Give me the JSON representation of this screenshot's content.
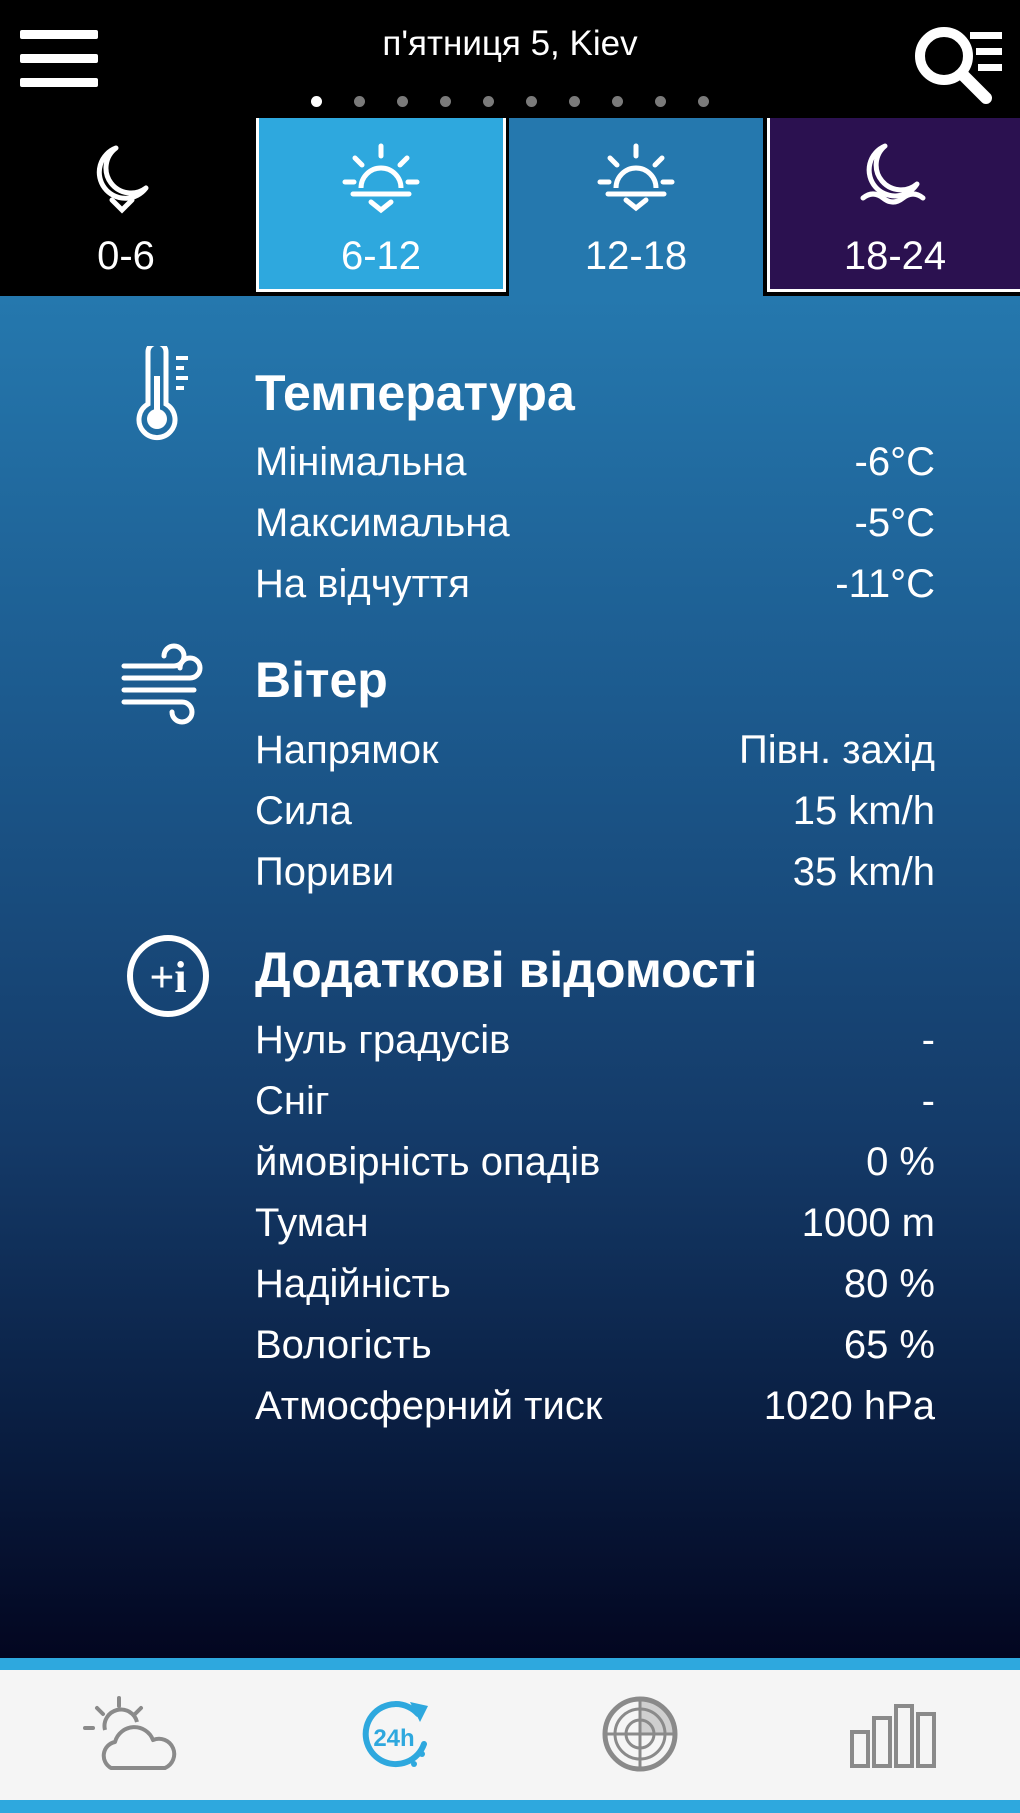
{
  "header": {
    "title": "п'ятниця 5, Kiev",
    "menu_icon": "hamburger-menu-icon",
    "search_icon": "search-list-icon",
    "page_dots": {
      "count": 10,
      "active_index": 0
    }
  },
  "tabs": [
    {
      "label": "0-6",
      "icon": "moon-night-icon"
    },
    {
      "label": "6-12",
      "icon": "sunrise-icon"
    },
    {
      "label": "12-18",
      "icon": "sun-day-icon",
      "selected": true
    },
    {
      "label": "18-24",
      "icon": "moon-evening-icon"
    }
  ],
  "temperature": {
    "title": "Температура",
    "icon": "thermometer-icon",
    "rows": [
      {
        "label": "Мінімальна",
        "value": "-6°C"
      },
      {
        "label": "Максимальна",
        "value": "-5°C"
      },
      {
        "label": "На відчуття",
        "value": "-11°C"
      }
    ]
  },
  "wind": {
    "title": "Вітер",
    "icon": "wind-icon",
    "rows": [
      {
        "label": "Напрямок",
        "value": "Півн. захід"
      },
      {
        "label": "Сила",
        "value": "15 km/h"
      },
      {
        "label": "Пориви",
        "value": "35 km/h"
      }
    ]
  },
  "extra": {
    "title": "Додаткові відомості",
    "icon": "info-plus-icon",
    "rows": [
      {
        "label": "Нуль градусів",
        "value": "-"
      },
      {
        "label": "Сніг",
        "value": "-"
      },
      {
        "label": "ймовірність опадів",
        "value": "0 %"
      },
      {
        "label": "Туман",
        "value": "1000 m"
      },
      {
        "label": "Надійність",
        "value": "80 %"
      },
      {
        "label": "Вологість",
        "value": "65 %"
      },
      {
        "label": "Атмосферний тиск",
        "value": "1020 hPa"
      }
    ]
  },
  "bottom_nav": [
    {
      "icon": "partly-cloudy-icon"
    },
    {
      "icon": "hourly-24h-icon",
      "text": "24h",
      "active": true
    },
    {
      "icon": "radar-icon"
    },
    {
      "icon": "bar-chart-icon"
    }
  ],
  "colors": {
    "accent": "#2ea8de",
    "tab_morning": "#2ea8de",
    "tab_day": "#2578ae",
    "tab_evening": "#2b1150",
    "nav_inactive": "#8a8a8a"
  }
}
